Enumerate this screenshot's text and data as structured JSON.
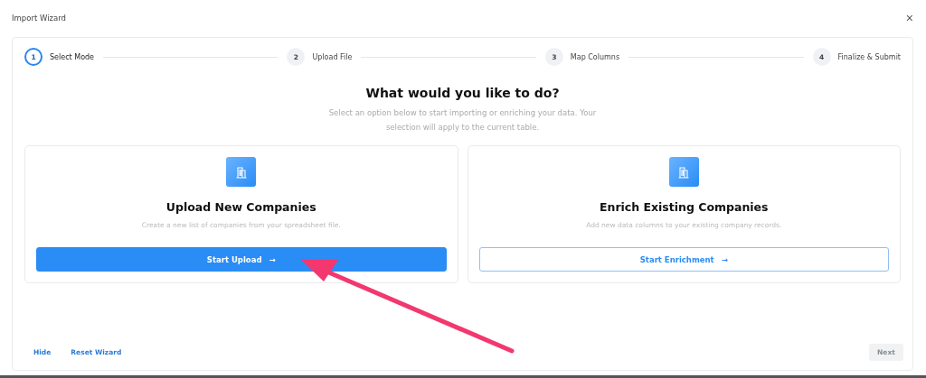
{
  "window": {
    "title": "Import Wizard",
    "close_label": "×"
  },
  "steps": [
    {
      "number": "1",
      "label": "Select Mode",
      "selected": true
    },
    {
      "number": "2",
      "label": "Upload File",
      "selected": false
    },
    {
      "number": "3",
      "label": "Map Columns",
      "selected": false
    },
    {
      "number": "4",
      "label": "Finalize & Submit",
      "selected": false
    }
  ],
  "heading": "What would you like to do?",
  "subtitle": "Select an option below to start importing or enriching your data. Your selection will apply to the current table.",
  "options": [
    {
      "title": "Upload New Companies",
      "description": "Create a new list of companies from your spreadsheet file.",
      "button": {
        "label": "Start Upload",
        "arrow": "→",
        "kind": "primary"
      }
    },
    {
      "title": "Enrich Existing Companies",
      "description": "Add new data columns to your existing company records.",
      "button": {
        "label": "Start Enrichment",
        "arrow": "→",
        "kind": "outline"
      }
    }
  ],
  "footer": {
    "links": [
      "Hide",
      "Reset Wizard"
    ],
    "next": {
      "label": "Next",
      "disabled": true
    }
  }
}
